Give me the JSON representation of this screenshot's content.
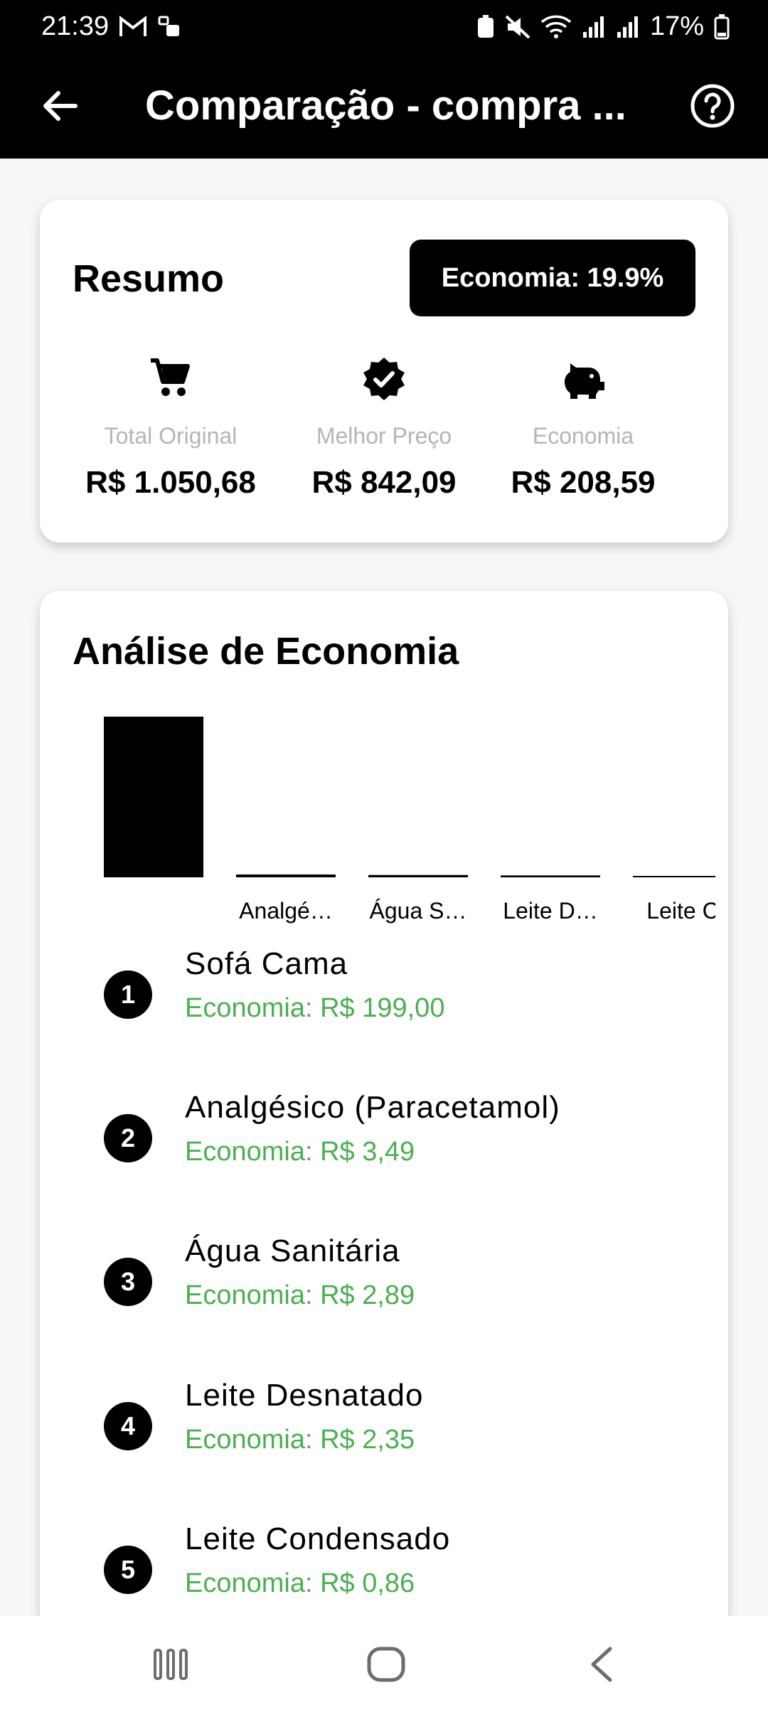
{
  "status_bar": {
    "time": "21:39",
    "battery": "17%"
  },
  "app_bar": {
    "title": "Comparação - compra ..."
  },
  "summary": {
    "heading": "Resumo",
    "badge": "Economia: 19.9%",
    "stats": [
      {
        "icon": "cart-icon",
        "label": "Total Original",
        "value": "R$ 1.050,68"
      },
      {
        "icon": "verified-badge-icon",
        "label": "Melhor Preço",
        "value": "R$ 842,09"
      },
      {
        "icon": "piggy-bank-icon",
        "label": "Economia",
        "value": "R$ 208,59"
      }
    ]
  },
  "analysis": {
    "heading": "Análise de Economia",
    "ranking": [
      {
        "rank": "1",
        "name": "Sofá Cama",
        "economy": "Economia: R$ 199,00"
      },
      {
        "rank": "2",
        "name": "Analgésico (Paracetamol)",
        "economy": "Economia: R$ 3,49"
      },
      {
        "rank": "3",
        "name": "Água Sanitária",
        "economy": "Economia: R$ 2,89"
      },
      {
        "rank": "4",
        "name": "Leite Desnatado",
        "economy": "Economia: R$ 2,35"
      },
      {
        "rank": "5",
        "name": "Leite Condensado",
        "economy": "Economia: R$ 0,86"
      }
    ]
  },
  "chart_data": {
    "type": "bar",
    "categories": [
      "",
      "Analgé…",
      "Água S…",
      "Leite D…",
      "Leite C"
    ],
    "values": [
      199.0,
      3.49,
      2.89,
      2.35,
      0.86
    ],
    "ylim": [
      0,
      199.0
    ],
    "grid": false,
    "bar_color": "#000000"
  },
  "colors": {
    "accent": "#000000",
    "economy_green": "#4caf50",
    "muted_label": "#b5b5b5"
  }
}
